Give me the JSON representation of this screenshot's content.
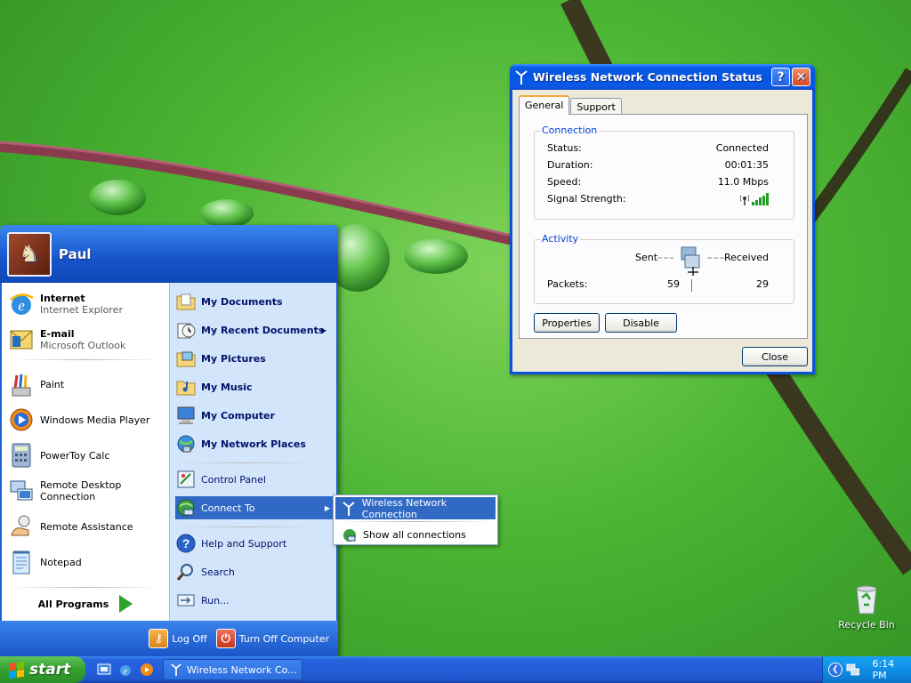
{
  "desktop": {
    "recycle_bin_label": "Recycle Bin"
  },
  "status_window": {
    "title": "Wireless Network Connection Status",
    "help_glyph": "?",
    "close_glyph": "✕",
    "tabs": [
      "General",
      "Support"
    ],
    "connection": {
      "legend": "Connection",
      "status_label": "Status:",
      "status_value": "Connected",
      "duration_label": "Duration:",
      "duration_value": "00:01:35",
      "speed_label": "Speed:",
      "speed_value": "11.0 Mbps",
      "signal_label": "Signal Strength:",
      "signal_bars": 5
    },
    "activity": {
      "legend": "Activity",
      "sent_label": "Sent",
      "received_label": "Received",
      "packets_label": "Packets:",
      "packets_sent": "59",
      "packets_received": "29"
    },
    "buttons": {
      "properties": "Properties",
      "disable": "Disable",
      "close": "Close"
    }
  },
  "start_menu": {
    "user_name": "Paul",
    "pinned": [
      {
        "title": "Internet",
        "subtitle": "Internet Explorer"
      },
      {
        "title": "E-mail",
        "subtitle": "Microsoft Outlook"
      }
    ],
    "recent": [
      "Paint",
      "Windows Media Player",
      "PowerToy Calc",
      "Remote Desktop Connection",
      "Remote Assistance",
      "Notepad"
    ],
    "all_programs": "All Programs",
    "places": [
      "My Documents",
      "My Recent Documents",
      "My Pictures",
      "My Music",
      "My Computer",
      "My Network Places"
    ],
    "system": [
      "Control Panel",
      "Connect To"
    ],
    "help": [
      "Help and Support",
      "Search",
      "Run..."
    ],
    "log_off": "Log Off",
    "turn_off": "Turn Off Computer",
    "arrow_glyph": "▶"
  },
  "connect_submenu": {
    "items": [
      "Wireless Network Connection",
      "Show all connections"
    ]
  },
  "taskbar": {
    "start_label": "start",
    "task_button": "Wireless Network Co...",
    "tray_chevron": "❮",
    "clock": "6:14 PM"
  },
  "colors": {
    "xp_blue": "#0a52d8",
    "start_green": "#36a331",
    "menu_highlight": "#316ac5",
    "legend_blue": "#0046d5"
  }
}
